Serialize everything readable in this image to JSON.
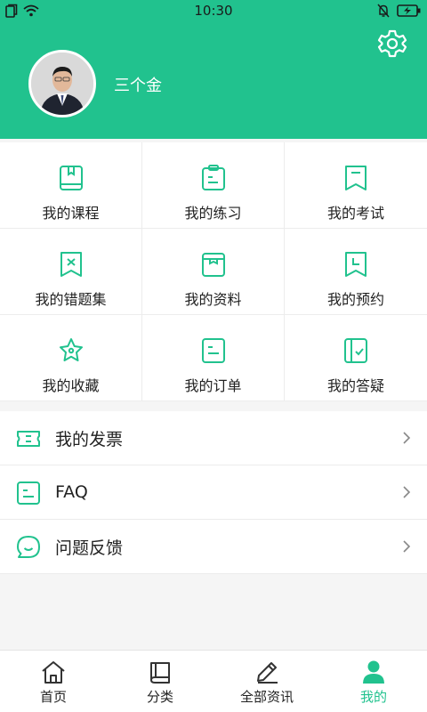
{
  "status_bar": {
    "time": "10:30"
  },
  "profile": {
    "username": "三个金"
  },
  "grid_items": [
    {
      "label": "我的课程",
      "icon": "book-icon"
    },
    {
      "label": "我的练习",
      "icon": "clipboard-icon"
    },
    {
      "label": "我的考试",
      "icon": "bookmark-icon"
    },
    {
      "label": "我的错题集",
      "icon": "error-bookmark-icon"
    },
    {
      "label": "我的资料",
      "icon": "archive-box-icon"
    },
    {
      "label": "我的预约",
      "icon": "clock-bookmark-icon"
    },
    {
      "label": "我的收藏",
      "icon": "star-icon"
    },
    {
      "label": "我的订单",
      "icon": "order-doc-icon"
    },
    {
      "label": "我的答疑",
      "icon": "notebook-check-icon"
    }
  ],
  "list_items": [
    {
      "label": "我的发票",
      "icon": "ticket-icon"
    },
    {
      "label": "FAQ",
      "icon": "faq-doc-icon"
    },
    {
      "label": "问题反馈",
      "icon": "chat-smile-icon"
    }
  ],
  "tabs": [
    {
      "label": "首页",
      "icon": "home-icon",
      "active": false
    },
    {
      "label": "分类",
      "icon": "books-icon",
      "active": false
    },
    {
      "label": "全部资讯",
      "icon": "pencil-icon",
      "active": false
    },
    {
      "label": "我的",
      "icon": "person-icon",
      "active": true
    }
  ],
  "colors": {
    "accent": "#21c28e",
    "text": "#222222",
    "background": "#f5f5f5"
  }
}
